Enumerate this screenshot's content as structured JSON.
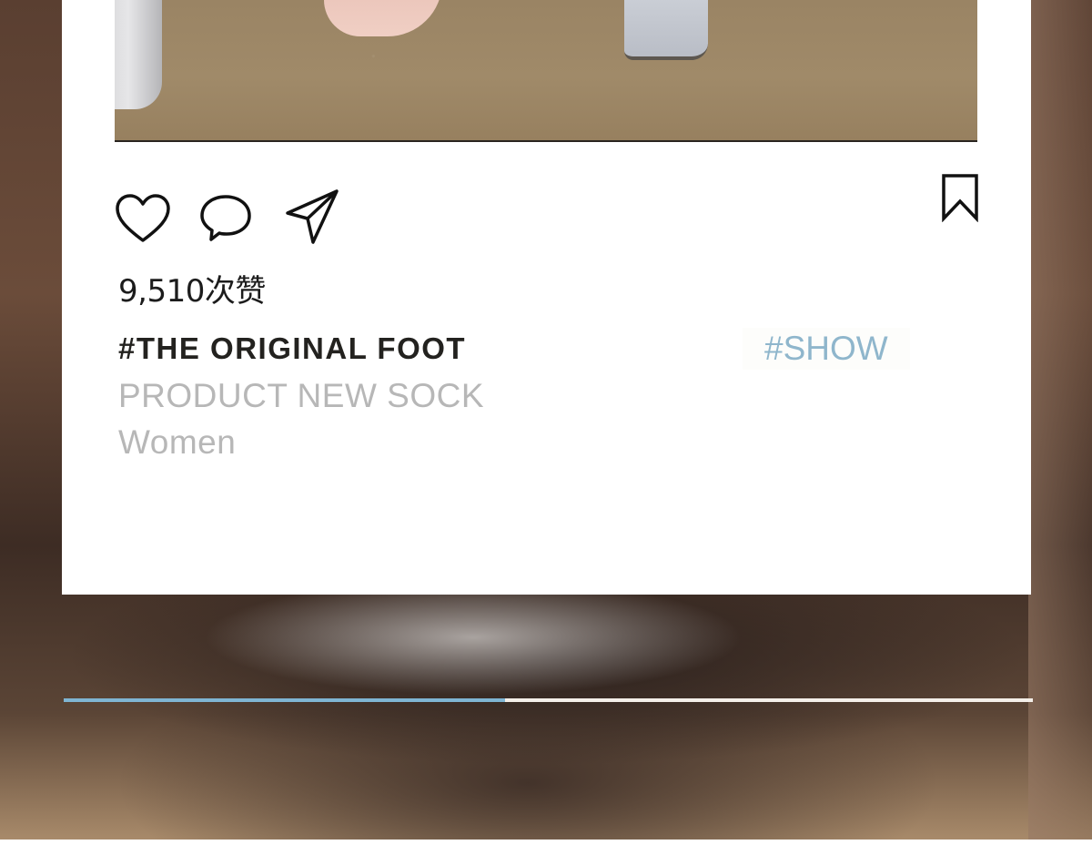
{
  "post": {
    "likes_text": "9,510次赞",
    "title": "#THE ORIGINAL FOOT",
    "subtitle": "PRODUCT NEW SOCK",
    "audience": "Women",
    "tag": "#SHOW"
  },
  "actions": {
    "like_icon": "heart-icon",
    "comment_icon": "comment-icon",
    "share_icon": "send-icon",
    "bookmark_icon": "bookmark-icon"
  },
  "progress": {
    "value_percent": 45.5,
    "fill_color": "#7fb5d3",
    "track_color": "#f4efe9"
  },
  "colors": {
    "tag": "#8fb6cc",
    "title": "#23221f",
    "muted": "#b7b7b7"
  }
}
